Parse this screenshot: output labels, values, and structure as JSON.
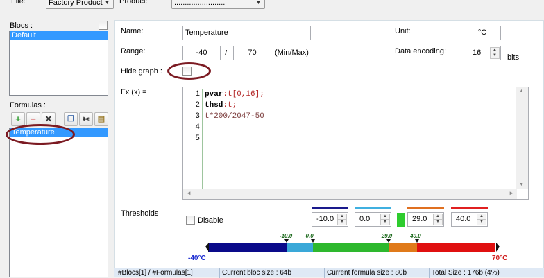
{
  "top": {
    "file_label": "File:",
    "file_value": "Factory Product",
    "product_label": "Product:",
    "product_value": "........................"
  },
  "blocs": {
    "label": "Blocs :",
    "items": [
      "Default"
    ]
  },
  "formulas": {
    "label": "Formulas :",
    "items": [
      "Temperature"
    ]
  },
  "form": {
    "name_label": "Name:",
    "name_value": "Temperature",
    "unit_label": "Unit:",
    "unit_value": "°C",
    "range_label": "Range:",
    "range_min": "-40",
    "range_sep": "/",
    "range_max": "70",
    "range_hint": "(Min/Max)",
    "encoding_label": "Data encoding:",
    "encoding_value": "16",
    "encoding_unit": "bits",
    "hide_graph_label": "Hide graph :",
    "fx_label": "Fx (x) ="
  },
  "code": {
    "line_numbers": [
      "1",
      "2",
      "3",
      "4",
      "5"
    ],
    "line1_kw": "pvar",
    "line1_rest": ":t[0,16];",
    "line2_kw": "thsd",
    "line2_rest": ":t;",
    "line3": "t*200/2047-50"
  },
  "thresholds": {
    "label": "Thresholds",
    "disable_label": "Disable",
    "values": [
      "-10.0",
      "0.0",
      "29.0",
      "40.0"
    ],
    "colors": [
      "#1a1a8c",
      "#40b0e0",
      "#e07020",
      "#e02020"
    ],
    "marker_labels": [
      "-10.0",
      "0.0",
      "29.0",
      "40.0"
    ],
    "min_label": "-40°C",
    "max_label": "70°C",
    "range": [
      -40,
      70
    ],
    "bands": [
      {
        "from": -40,
        "to": -10,
        "color": "#0a0a8a"
      },
      {
        "from": -10,
        "to": 0,
        "color": "#3aa8d8"
      },
      {
        "from": 0,
        "to": 29,
        "color": "#2eb82e"
      },
      {
        "from": 29,
        "to": 40,
        "color": "#e07a1a"
      },
      {
        "from": 40,
        "to": 70,
        "color": "#e01010"
      }
    ],
    "indicator_color": "#2ecc2e"
  },
  "status": {
    "blocs_formulas": "#Blocs[1] / #Formulas[1]",
    "bloc_size": "Current bloc size : 64b",
    "formula_size": "Current formula size : 80b",
    "total_size": "Total Size : 176b (4%)"
  }
}
